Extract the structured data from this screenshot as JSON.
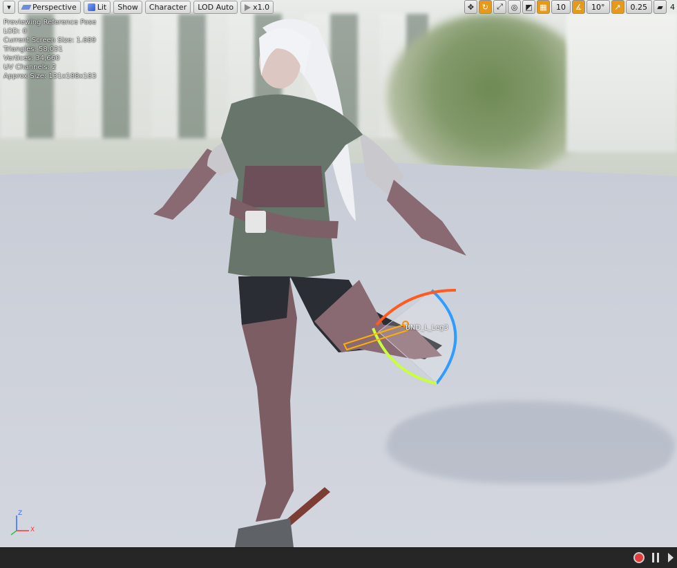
{
  "toolbar": {
    "menu_arrow": "▾",
    "perspective_label": "Perspective",
    "lit_label": "Lit",
    "show_label": "Show",
    "character_label": "Character",
    "lod_label": "LOD Auto",
    "speed_label": "x1.0"
  },
  "toolbar_right": {
    "grid_snap_value": "10",
    "rotation_snap_value": "10°",
    "scale_snap_value": "0.25",
    "camera_speed_value": "4"
  },
  "stats": {
    "line1": "Previewing Reference Pose",
    "line2": "LOD: 0",
    "line3": "Current Screen Size: 1.689",
    "line4": "Triangles: 58,031",
    "line5": "Vertices: 34,660",
    "line6": "UV Channels: 2",
    "line7": "Approx Size: 131x188x183"
  },
  "bone_label": "BND_L_Leg3",
  "axis": {
    "z": "Z",
    "x": "X"
  },
  "colors": {
    "accent_orange": "#e69a1c",
    "record_red": "#e33c3c",
    "bottom_bar": "#262626"
  }
}
